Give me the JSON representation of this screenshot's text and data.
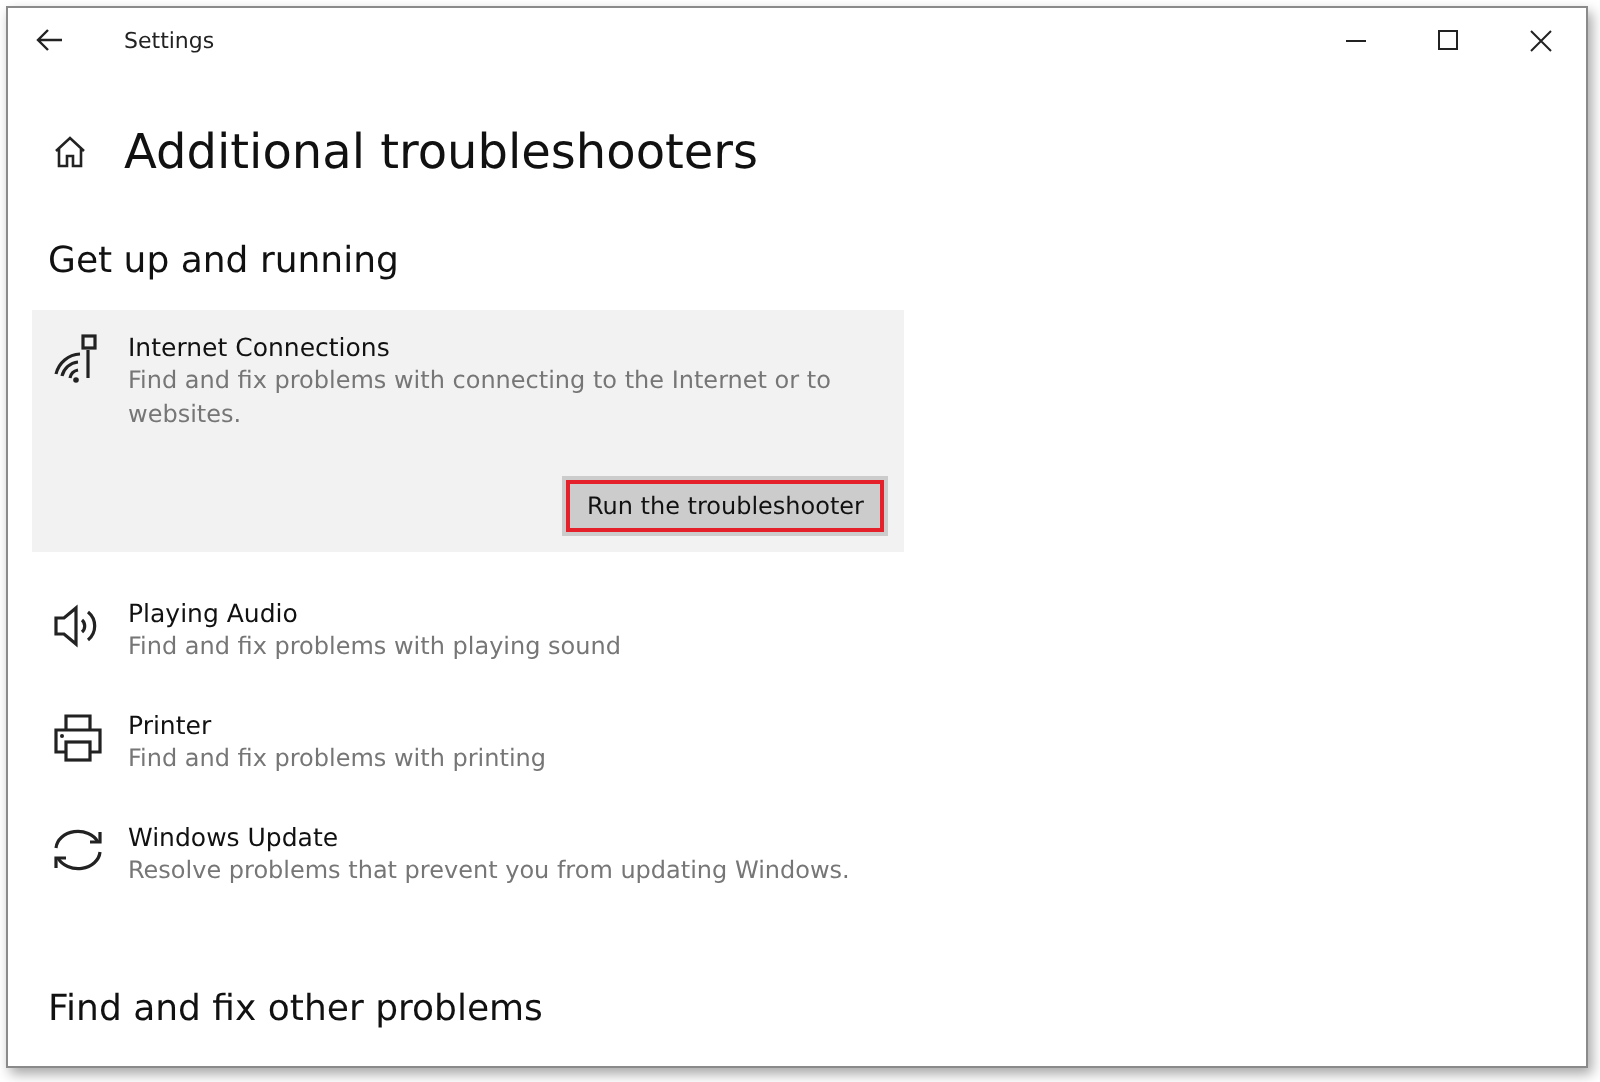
{
  "window": {
    "title": "Settings"
  },
  "page": {
    "title": "Additional troubleshooters"
  },
  "sections": [
    {
      "heading": "Get up and running",
      "items": [
        {
          "kind": "wifi",
          "name": "Internet Connections",
          "description": "Find and fix problems with connecting to the Internet or to websites.",
          "expanded": true,
          "button": {
            "label": "Run the troubleshooter",
            "highlighted": true
          }
        },
        {
          "kind": "audio",
          "name": "Playing Audio",
          "description": "Find and fix problems with playing sound",
          "expanded": false
        },
        {
          "kind": "printer",
          "name": "Printer",
          "description": "Find and fix problems with printing",
          "expanded": false
        },
        {
          "kind": "update",
          "name": "Windows Update",
          "description": "Resolve problems that prevent you from updating Windows.",
          "expanded": false
        }
      ]
    },
    {
      "heading": "Find and fix other problems"
    }
  ]
}
